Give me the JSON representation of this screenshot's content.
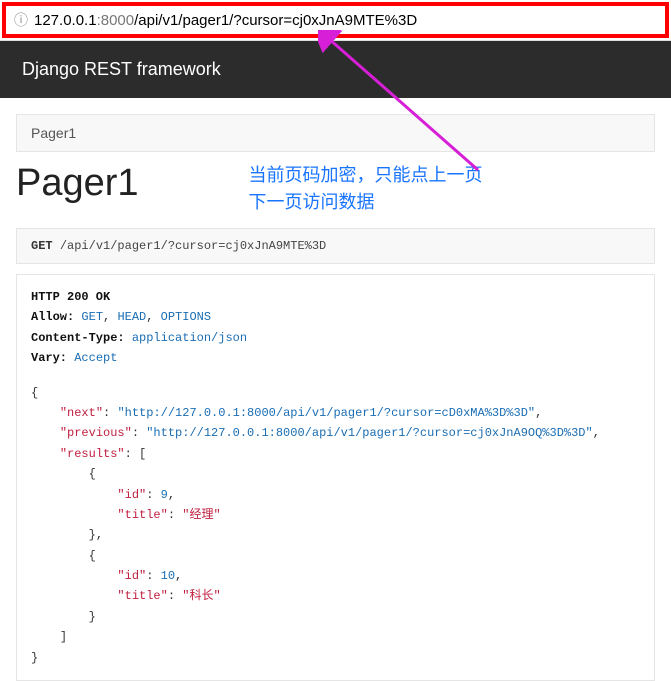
{
  "url": {
    "host": "127.0.0.1",
    "port": ":8000",
    "path": "/api/v1/pager1/?cursor=cj0xJnA9MTE%3D"
  },
  "header": {
    "brand": "Django REST framework"
  },
  "breadcrumb": {
    "label": "Pager1"
  },
  "page": {
    "title": "Pager1"
  },
  "annotation": {
    "text": "当前页码加密，只能点上一页\n下一页访问数据"
  },
  "request": {
    "method": "GET",
    "url": "/api/v1/pager1/?cursor=cj0xJnA9MTE%3D"
  },
  "response": {
    "status_line": "HTTP 200 OK",
    "headers": {
      "allow_label": "Allow:",
      "allow_get": "GET",
      "allow_head": "HEAD",
      "allow_options": "OPTIONS",
      "ct_label": "Content-Type:",
      "ct_value": "application/json",
      "vary_label": "Vary:",
      "vary_value": "Accept"
    },
    "body": {
      "next_key": "\"next\"",
      "next_val": "\"http://127.0.0.1:8000/api/v1/pager1/?cursor=cD0xMA%3D%3D\"",
      "prev_key": "\"previous\"",
      "prev_val": "\"http://127.0.0.1:8000/api/v1/pager1/?cursor=cj0xJnA9OQ%3D%3D\"",
      "results_key": "\"results\"",
      "r0_id_key": "\"id\"",
      "r0_id_val": "9",
      "r0_title_key": "\"title\"",
      "r0_title_val": "\"经理\"",
      "r1_id_key": "\"id\"",
      "r1_id_val": "10",
      "r1_title_key": "\"title\"",
      "r1_title_val": "\"科长\""
    }
  }
}
